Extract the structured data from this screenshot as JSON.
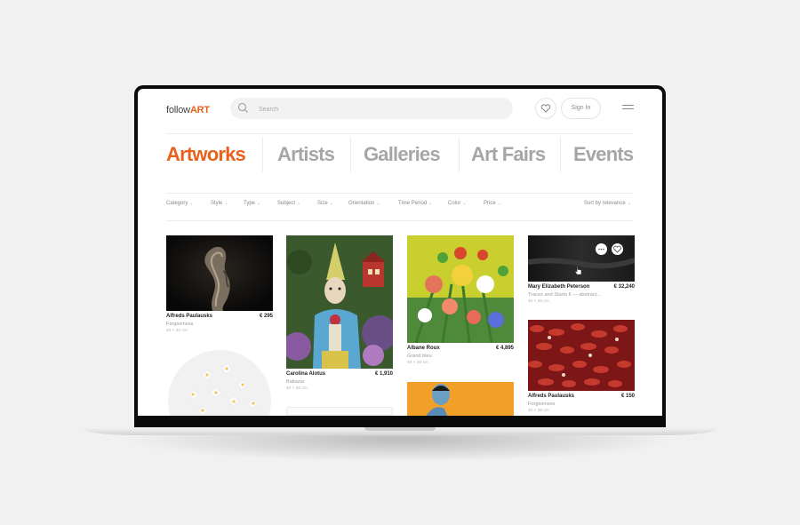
{
  "header": {
    "logo_prefix": "follow",
    "logo_accent": "ART",
    "search_placeholder": "Search",
    "signin_label": "Sign In"
  },
  "tabs": [
    {
      "label": "Artworks",
      "active": true
    },
    {
      "label": "Artists",
      "active": false
    },
    {
      "label": "Galleries",
      "active": false
    },
    {
      "label": "Art Fairs",
      "active": false
    },
    {
      "label": "Events",
      "active": false
    }
  ],
  "filters": [
    "Category",
    "Style",
    "Type",
    "Subject",
    "Size",
    "Orientation",
    "Time Period",
    "Color",
    "Price"
  ],
  "sort_label": "Sort by relevance",
  "artworks": [
    {
      "artist": "Alfreds Paulausks",
      "price": "€ 295",
      "title": "Forgiveness",
      "size": "40 × 30 cm"
    },
    {
      "artist": "Carolina Alotus",
      "price": "€ 1,910",
      "title": "Baltazar",
      "size": "40 × 30 cm"
    },
    {
      "artist": "Albane Roux",
      "price": "€ 4,895",
      "title": "Grand bleu",
      "size": "40 × 30 cm"
    },
    {
      "artist": "Mary Elizabeth Peterson",
      "price": "€ 32,240",
      "title": "Traces and Starts II — abstract...",
      "size": "40 × 30 cm"
    },
    {
      "artist": "Alfreds Paulausks",
      "price": "€ 150",
      "title": "Forgiveness",
      "size": "40 × 30 cm"
    }
  ],
  "colors": {
    "accent": "#e8621b",
    "muted_tab": "#a6a6a6",
    "text": "#222222",
    "subtle_text": "#9a9a9a"
  },
  "icons": [
    "search-icon",
    "heart-icon",
    "menu-icon",
    "chevron-down-icon",
    "more-icon",
    "cursor-hand-icon"
  ]
}
